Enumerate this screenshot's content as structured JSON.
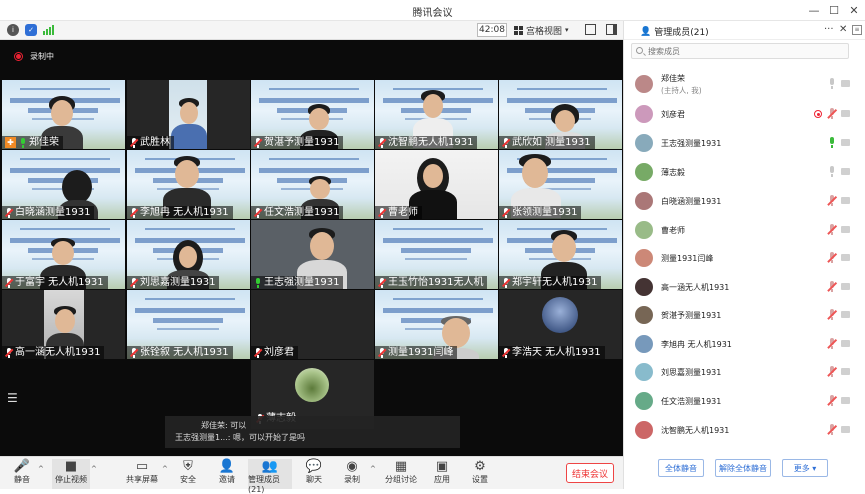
{
  "app": {
    "title": "腾讯会议"
  },
  "topbar": {
    "timer": "42:08",
    "view_label": "宫格视图"
  },
  "recording": {
    "label": "录制中"
  },
  "tiles": [
    {
      "name": "郑佳荣",
      "host": true,
      "mic": "on"
    },
    {
      "name": "武胜林",
      "mic": "muted"
    },
    {
      "name": "贺湛予测量1931",
      "mic": "muted"
    },
    {
      "name": "沈智鹏无人机1931",
      "mic": "muted"
    },
    {
      "name": "武欣如 测量1931",
      "mic": "muted"
    },
    {
      "name": "白晓涵测量1931",
      "mic": "muted"
    },
    {
      "name": "李旭冉 无人机1931",
      "mic": "muted"
    },
    {
      "name": "任文浩测量1931",
      "mic": "muted"
    },
    {
      "name": "曹老师",
      "mic": "muted"
    },
    {
      "name": "张领测量1931",
      "mic": "muted"
    },
    {
      "name": "于富宇 无人机1931",
      "mic": "muted"
    },
    {
      "name": "刘思嘉测量1931",
      "mic": "muted"
    },
    {
      "name": "王志强测量1931",
      "mic": "green"
    },
    {
      "name": "王玉竹怡1931无人机",
      "mic": "muted"
    },
    {
      "name": "郑宇轩无人机1931",
      "mic": "muted"
    },
    {
      "name": "高一涵无人机1931",
      "mic": "muted"
    },
    {
      "name": "张铨叙 无人机1931",
      "mic": "muted"
    },
    {
      "name": "刘彦君",
      "mic": "muted"
    },
    {
      "name": "测量1931闫峰",
      "mic": "muted"
    },
    {
      "name": "李浩天 无人机1931",
      "mic": "muted"
    },
    {
      "name": "薄志毅",
      "mic": "muted"
    }
  ],
  "chat": [
    {
      "sender": "郑佳荣:",
      "text": "可以"
    },
    {
      "sender": "王志强测量1...:",
      "text": "嗯，可以开始了是吗"
    }
  ],
  "toolbar": {
    "mute": "静音",
    "stop_video": "停止视频",
    "share": "共享屏幕",
    "security": "安全",
    "invite": "邀请",
    "members": "管理成员(21)",
    "chat": "聊天",
    "record": "录制",
    "breakout": "分组讨论",
    "apps": "应用",
    "settings": "设置",
    "end": "结束会议"
  },
  "panel": {
    "title": "管理成员(21)",
    "search_placeholder": "搜索成员",
    "members": [
      {
        "name": "郑佳荣",
        "sub": "(主持人, 我)",
        "mic": "idle",
        "color": "#b88"
      },
      {
        "name": "刘彦君",
        "mic": "off",
        "rec": true,
        "color": "#c9b"
      },
      {
        "name": "王志强测量1931",
        "mic": "on",
        "color": "#8ab"
      },
      {
        "name": "薄志毅",
        "mic": "idle",
        "color": "#7a6"
      },
      {
        "name": "白晓涵测量1931",
        "mic": "off",
        "color": "#a77"
      },
      {
        "name": "曹老师",
        "mic": "off",
        "color": "#9b8"
      },
      {
        "name": "测量1931闫峰",
        "mic": "off",
        "color": "#c87"
      },
      {
        "name": "高一涵无人机1931",
        "mic": "off",
        "color": "#433"
      },
      {
        "name": "贺湛予测量1931",
        "mic": "off",
        "color": "#765"
      },
      {
        "name": "李旭冉 无人机1931",
        "mic": "off",
        "color": "#79b"
      },
      {
        "name": "刘思嘉测量1931",
        "mic": "off",
        "color": "#8bc"
      },
      {
        "name": "任文浩测量1931",
        "mic": "off",
        "color": "#6a8"
      },
      {
        "name": "沈智鹏无人机1931",
        "mic": "off",
        "color": "#c66"
      }
    ],
    "mute_all": "全体静音",
    "unmute_all": "解除全体静音",
    "more": "更多 ▾"
  }
}
